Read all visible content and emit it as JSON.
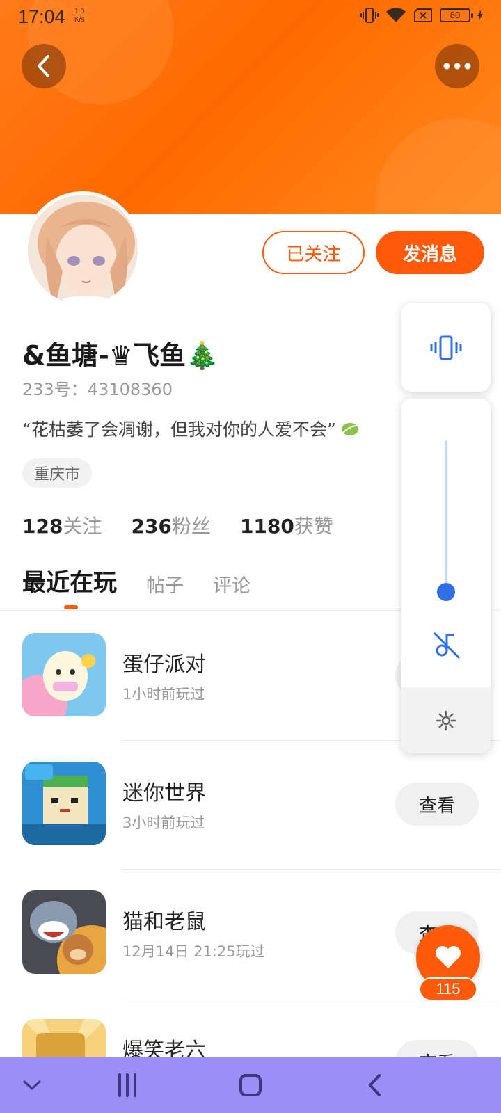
{
  "status_bar": {
    "time": "17:04",
    "speed_value": "1.0",
    "speed_unit": "K/s",
    "battery": "80"
  },
  "profile": {
    "follow_button": "已关注",
    "message_button": "发消息",
    "username": "&鱼塘-♛飞鱼🎄",
    "user_id": "233号：43108360",
    "bio": "“花枯萎了会凋谢，但我对你的人爱不会”",
    "location": "重庆市"
  },
  "stats": [
    {
      "value": "128",
      "label": "关注"
    },
    {
      "value": "236",
      "label": "粉丝"
    },
    {
      "value": "1180",
      "label": "获赞"
    }
  ],
  "tabs": [
    {
      "label": "最近在玩",
      "active": true
    },
    {
      "label": "帖子",
      "active": false
    },
    {
      "label": "评论",
      "active": false
    }
  ],
  "games": [
    {
      "name": "蛋仔派对",
      "time": "1小时前玩过",
      "button": "查看"
    },
    {
      "name": "迷你世界",
      "time": "3小时前玩过",
      "button": "查看"
    },
    {
      "name": "猫和老鼠",
      "time": "12月14日 21:25玩过",
      "button": "查看"
    },
    {
      "name": "爆笑老六",
      "time": "",
      "button": "查看"
    }
  ],
  "volume_panel": {
    "level_fraction": 0.05,
    "accent": "#2f6fe6"
  },
  "like": {
    "count": "115"
  },
  "colors": {
    "accent": "#ff5a0a",
    "nav_bar": "#9b8ff5"
  }
}
